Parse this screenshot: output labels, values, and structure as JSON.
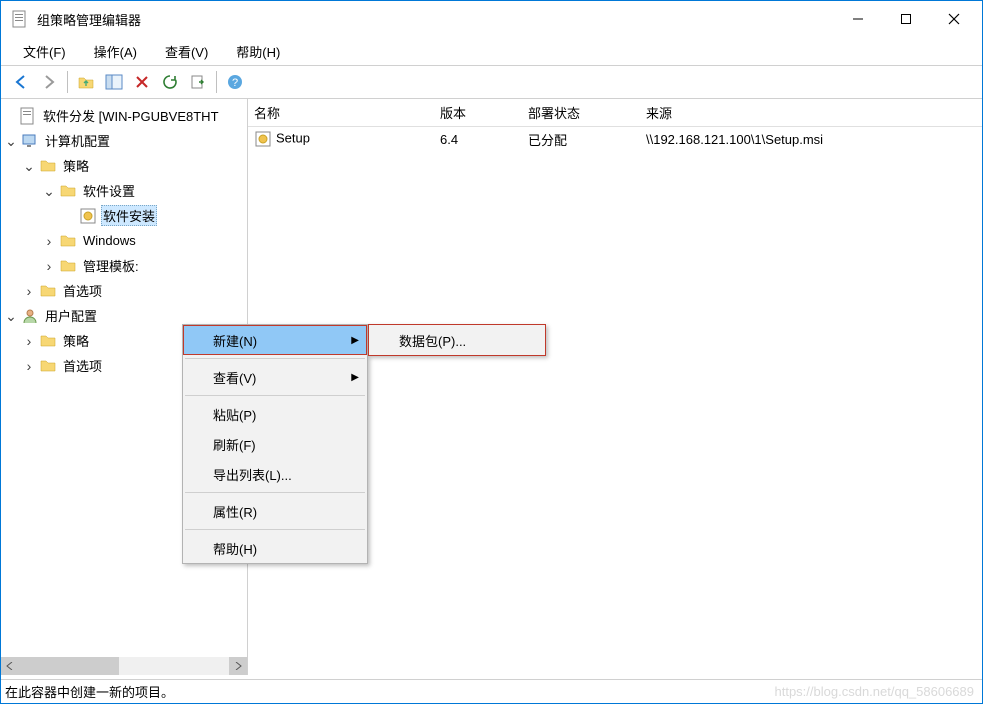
{
  "window": {
    "title": "组策略管理编辑器"
  },
  "menubar": {
    "file": "文件(F)",
    "action": "操作(A)",
    "view": "查看(V)",
    "help": "帮助(H)"
  },
  "tree": {
    "root": "软件分发 [WIN-PGUBVE8THT",
    "computer_config": "计算机配置",
    "policies": "策略",
    "software_settings": "软件设置",
    "software_install": "软件安装",
    "windows_settings": "Windows",
    "admin_templates": "管理模板:",
    "preferences": "首选项",
    "user_config": "用户配置",
    "user_policies": "策略",
    "user_preferences": "首选项"
  },
  "list": {
    "headers": {
      "name": "名称",
      "version": "版本",
      "state": "部署状态",
      "source": "来源"
    },
    "rows": [
      {
        "name": "Setup",
        "version": "6.4",
        "state": "已分配",
        "source": "\\\\192.168.121.100\\1\\Setup.msi"
      }
    ]
  },
  "context_menu": {
    "new": "新建(N)",
    "view": "查看(V)",
    "paste": "粘贴(P)",
    "refresh": "刷新(F)",
    "export_list": "导出列表(L)...",
    "properties": "属性(R)",
    "help": "帮助(H)",
    "submenu_package": "数据包(P)..."
  },
  "statusbar": {
    "text": "在此容器中创建一新的项目。"
  },
  "watermark": "https://blog.csdn.net/qq_58606689"
}
